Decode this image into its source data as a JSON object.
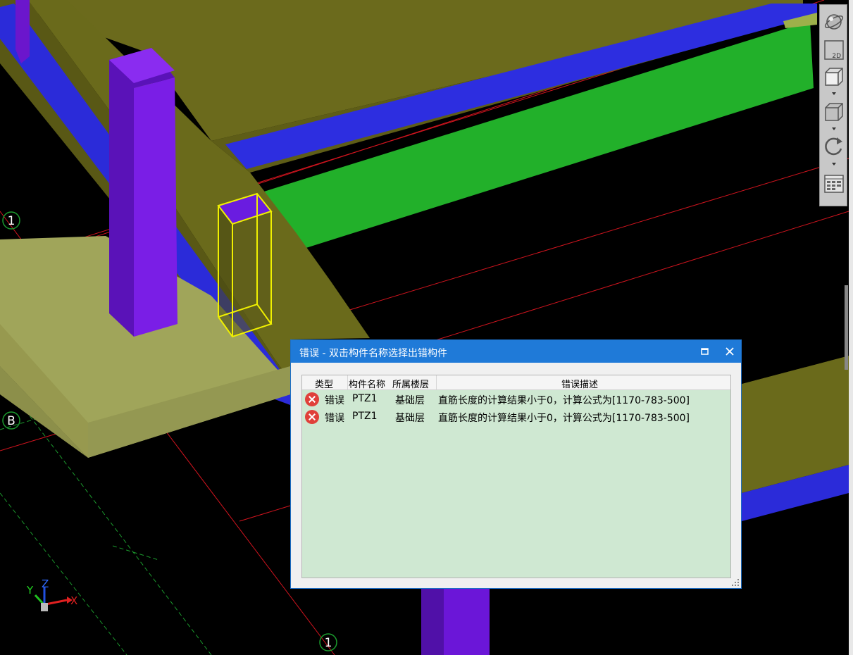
{
  "scene": {
    "grid_labels": [
      "1",
      "B",
      "1"
    ],
    "axis_labels": {
      "x": "X",
      "y": "Y",
      "z": "Z"
    }
  },
  "toolbar": {
    "buttons": [
      {
        "name": "orbit",
        "icon": "globe-icon"
      },
      {
        "name": "2d-view",
        "icon": "2d-view-icon",
        "label": "2D"
      },
      {
        "name": "3d-view",
        "icon": "cube-view-icon"
      },
      {
        "name": "render-mode",
        "icon": "solid-cube-icon"
      },
      {
        "name": "rotate",
        "icon": "rotate-icon"
      },
      {
        "name": "display-settings",
        "icon": "panel-grid-icon"
      }
    ]
  },
  "dialog": {
    "title": "错误 - 双击构件名称选择出错构件",
    "columns": [
      "类型",
      "构件名称",
      "所属楼层",
      "错误描述"
    ],
    "rows": [
      {
        "type": "错误",
        "name": "PTZ1",
        "floor": "基础层",
        "description": "直筋长度的计算结果小于0，计算公式为[1170-783-500]"
      },
      {
        "type": "错误",
        "name": "PTZ1",
        "floor": "基础层",
        "description": "直筋长度的计算结果小于0，计算公式为[1170-783-500]"
      }
    ],
    "colors": {
      "titlebar": "#1f7ad8",
      "list_bg": "#cfe8d2",
      "error_icon": "#e0403a"
    }
  }
}
